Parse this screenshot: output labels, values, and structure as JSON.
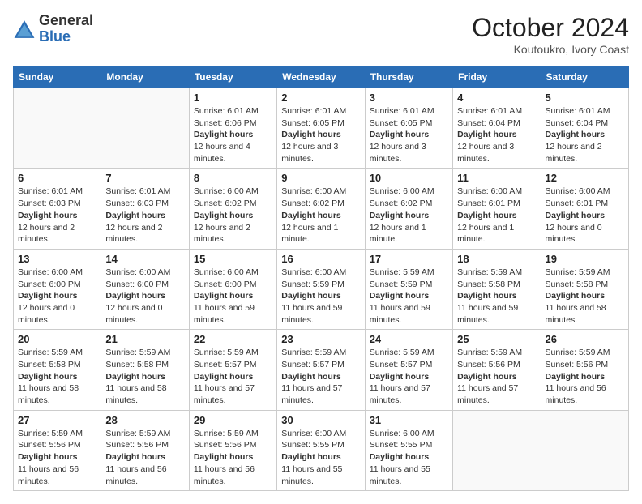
{
  "header": {
    "logo_general": "General",
    "logo_blue": "Blue",
    "month_title": "October 2024",
    "subtitle": "Koutoukro, Ivory Coast"
  },
  "weekdays": [
    "Sunday",
    "Monday",
    "Tuesday",
    "Wednesday",
    "Thursday",
    "Friday",
    "Saturday"
  ],
  "weeks": [
    [
      {
        "day": "",
        "sunrise": "",
        "sunset": "",
        "daylight": ""
      },
      {
        "day": "",
        "sunrise": "",
        "sunset": "",
        "daylight": ""
      },
      {
        "day": "1",
        "sunrise": "Sunrise: 6:01 AM",
        "sunset": "Sunset: 6:06 PM",
        "daylight": "Daylight: 12 hours and 4 minutes."
      },
      {
        "day": "2",
        "sunrise": "Sunrise: 6:01 AM",
        "sunset": "Sunset: 6:05 PM",
        "daylight": "Daylight: 12 hours and 3 minutes."
      },
      {
        "day": "3",
        "sunrise": "Sunrise: 6:01 AM",
        "sunset": "Sunset: 6:05 PM",
        "daylight": "Daylight: 12 hours and 3 minutes."
      },
      {
        "day": "4",
        "sunrise": "Sunrise: 6:01 AM",
        "sunset": "Sunset: 6:04 PM",
        "daylight": "Daylight: 12 hours and 3 minutes."
      },
      {
        "day": "5",
        "sunrise": "Sunrise: 6:01 AM",
        "sunset": "Sunset: 6:04 PM",
        "daylight": "Daylight: 12 hours and 2 minutes."
      }
    ],
    [
      {
        "day": "6",
        "sunrise": "Sunrise: 6:01 AM",
        "sunset": "Sunset: 6:03 PM",
        "daylight": "Daylight: 12 hours and 2 minutes."
      },
      {
        "day": "7",
        "sunrise": "Sunrise: 6:01 AM",
        "sunset": "Sunset: 6:03 PM",
        "daylight": "Daylight: 12 hours and 2 minutes."
      },
      {
        "day": "8",
        "sunrise": "Sunrise: 6:00 AM",
        "sunset": "Sunset: 6:02 PM",
        "daylight": "Daylight: 12 hours and 2 minutes."
      },
      {
        "day": "9",
        "sunrise": "Sunrise: 6:00 AM",
        "sunset": "Sunset: 6:02 PM",
        "daylight": "Daylight: 12 hours and 1 minute."
      },
      {
        "day": "10",
        "sunrise": "Sunrise: 6:00 AM",
        "sunset": "Sunset: 6:02 PM",
        "daylight": "Daylight: 12 hours and 1 minute."
      },
      {
        "day": "11",
        "sunrise": "Sunrise: 6:00 AM",
        "sunset": "Sunset: 6:01 PM",
        "daylight": "Daylight: 12 hours and 1 minute."
      },
      {
        "day": "12",
        "sunrise": "Sunrise: 6:00 AM",
        "sunset": "Sunset: 6:01 PM",
        "daylight": "Daylight: 12 hours and 0 minutes."
      }
    ],
    [
      {
        "day": "13",
        "sunrise": "Sunrise: 6:00 AM",
        "sunset": "Sunset: 6:00 PM",
        "daylight": "Daylight: 12 hours and 0 minutes."
      },
      {
        "day": "14",
        "sunrise": "Sunrise: 6:00 AM",
        "sunset": "Sunset: 6:00 PM",
        "daylight": "Daylight: 12 hours and 0 minutes."
      },
      {
        "day": "15",
        "sunrise": "Sunrise: 6:00 AM",
        "sunset": "Sunset: 6:00 PM",
        "daylight": "Daylight: 11 hours and 59 minutes."
      },
      {
        "day": "16",
        "sunrise": "Sunrise: 6:00 AM",
        "sunset": "Sunset: 5:59 PM",
        "daylight": "Daylight: 11 hours and 59 minutes."
      },
      {
        "day": "17",
        "sunrise": "Sunrise: 5:59 AM",
        "sunset": "Sunset: 5:59 PM",
        "daylight": "Daylight: 11 hours and 59 minutes."
      },
      {
        "day": "18",
        "sunrise": "Sunrise: 5:59 AM",
        "sunset": "Sunset: 5:58 PM",
        "daylight": "Daylight: 11 hours and 59 minutes."
      },
      {
        "day": "19",
        "sunrise": "Sunrise: 5:59 AM",
        "sunset": "Sunset: 5:58 PM",
        "daylight": "Daylight: 11 hours and 58 minutes."
      }
    ],
    [
      {
        "day": "20",
        "sunrise": "Sunrise: 5:59 AM",
        "sunset": "Sunset: 5:58 PM",
        "daylight": "Daylight: 11 hours and 58 minutes."
      },
      {
        "day": "21",
        "sunrise": "Sunrise: 5:59 AM",
        "sunset": "Sunset: 5:58 PM",
        "daylight": "Daylight: 11 hours and 58 minutes."
      },
      {
        "day": "22",
        "sunrise": "Sunrise: 5:59 AM",
        "sunset": "Sunset: 5:57 PM",
        "daylight": "Daylight: 11 hours and 57 minutes."
      },
      {
        "day": "23",
        "sunrise": "Sunrise: 5:59 AM",
        "sunset": "Sunset: 5:57 PM",
        "daylight": "Daylight: 11 hours and 57 minutes."
      },
      {
        "day": "24",
        "sunrise": "Sunrise: 5:59 AM",
        "sunset": "Sunset: 5:57 PM",
        "daylight": "Daylight: 11 hours and 57 minutes."
      },
      {
        "day": "25",
        "sunrise": "Sunrise: 5:59 AM",
        "sunset": "Sunset: 5:56 PM",
        "daylight": "Daylight: 11 hours and 57 minutes."
      },
      {
        "day": "26",
        "sunrise": "Sunrise: 5:59 AM",
        "sunset": "Sunset: 5:56 PM",
        "daylight": "Daylight: 11 hours and 56 minutes."
      }
    ],
    [
      {
        "day": "27",
        "sunrise": "Sunrise: 5:59 AM",
        "sunset": "Sunset: 5:56 PM",
        "daylight": "Daylight: 11 hours and 56 minutes."
      },
      {
        "day": "28",
        "sunrise": "Sunrise: 5:59 AM",
        "sunset": "Sunset: 5:56 PM",
        "daylight": "Daylight: 11 hours and 56 minutes."
      },
      {
        "day": "29",
        "sunrise": "Sunrise: 5:59 AM",
        "sunset": "Sunset: 5:56 PM",
        "daylight": "Daylight: 11 hours and 56 minutes."
      },
      {
        "day": "30",
        "sunrise": "Sunrise: 6:00 AM",
        "sunset": "Sunset: 5:55 PM",
        "daylight": "Daylight: 11 hours and 55 minutes."
      },
      {
        "day": "31",
        "sunrise": "Sunrise: 6:00 AM",
        "sunset": "Sunset: 5:55 PM",
        "daylight": "Daylight: 11 hours and 55 minutes."
      },
      {
        "day": "",
        "sunrise": "",
        "sunset": "",
        "daylight": ""
      },
      {
        "day": "",
        "sunrise": "",
        "sunset": "",
        "daylight": ""
      }
    ]
  ]
}
